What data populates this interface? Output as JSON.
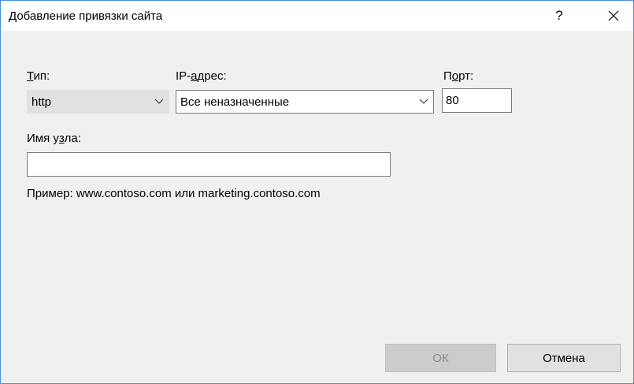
{
  "dialog": {
    "title": "Добавление привязки сайта",
    "help_label": "?"
  },
  "fields": {
    "type": {
      "label_u": "Т",
      "label_rest": "ип:",
      "value": "http"
    },
    "ip": {
      "label_pre": "IP-",
      "label_u": "а",
      "label_rest": "дрес:",
      "value": "Все неназначенные"
    },
    "port": {
      "label_pre": "П",
      "label_u": "о",
      "label_rest": "рт:",
      "value": "80"
    },
    "host": {
      "label_pre": "Имя у",
      "label_u": "з",
      "label_rest": "ла:",
      "value": ""
    }
  },
  "example_text": "Пример: www.contoso.com или marketing.contoso.com",
  "buttons": {
    "ok": "ОК",
    "cancel": "Отмена"
  },
  "icons": {
    "close": "close-icon",
    "chevron": "chevron-down-icon"
  }
}
